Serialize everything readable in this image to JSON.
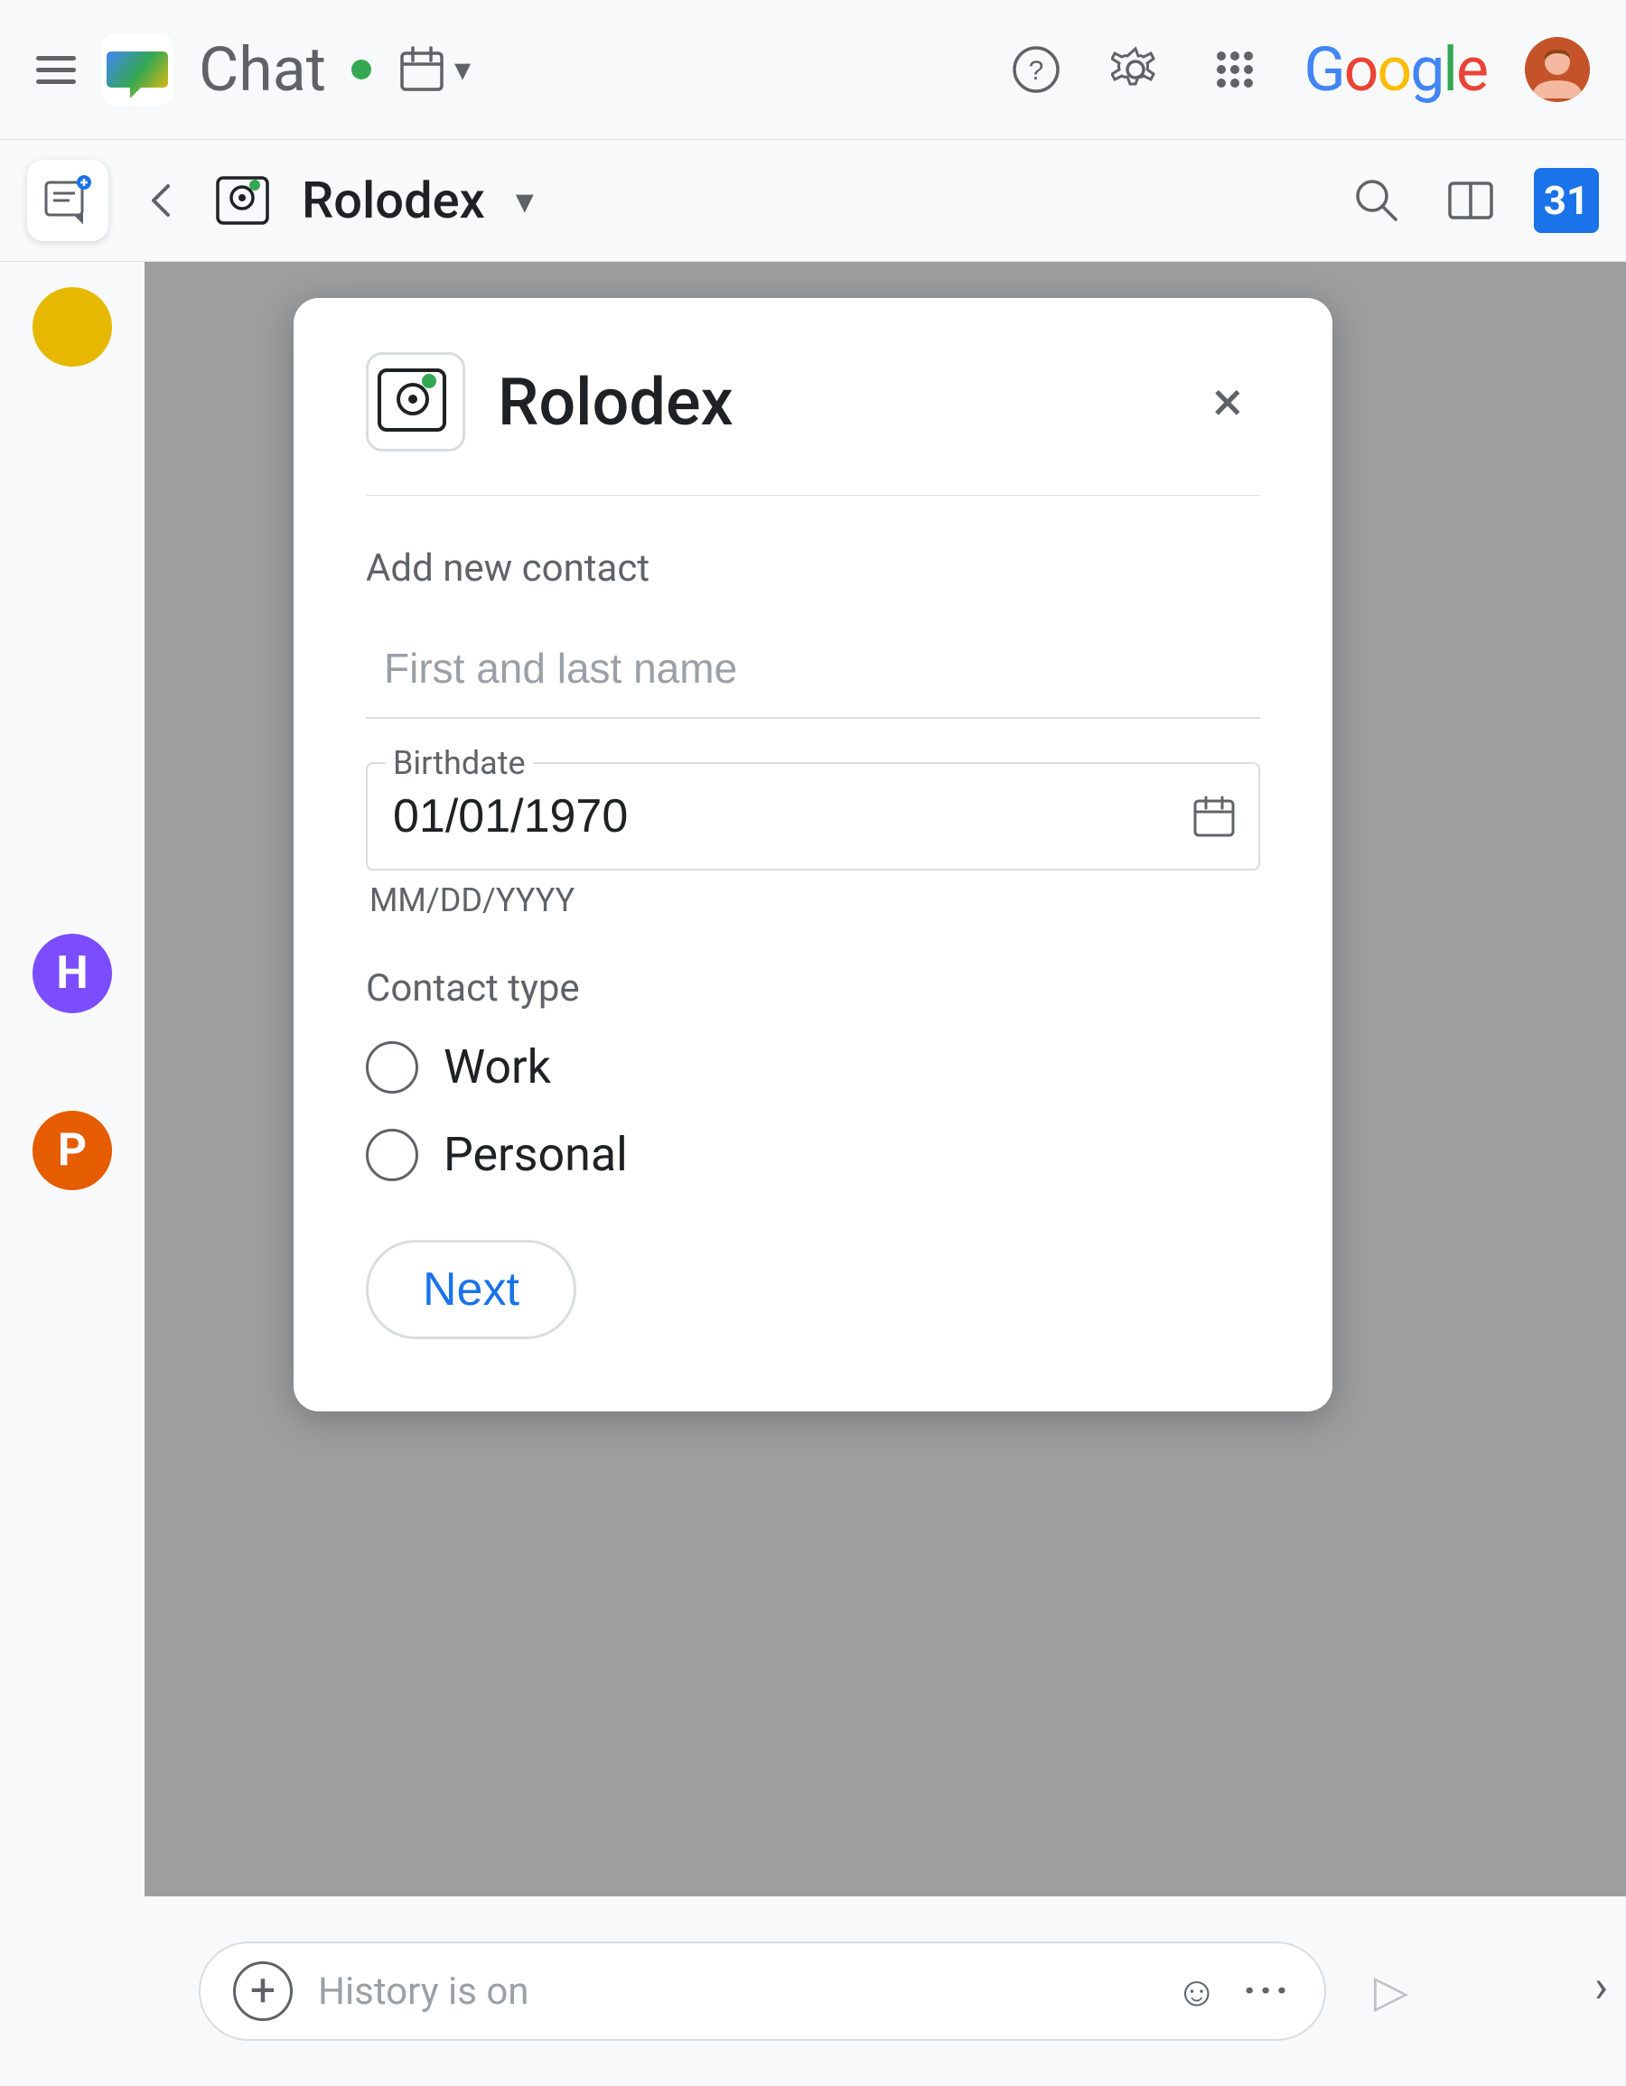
{
  "topbar": {
    "app_title": "Chat",
    "status_color": "#34a853",
    "google_text": "Google",
    "help_tooltip": "Help",
    "settings_tooltip": "Settings",
    "apps_tooltip": "Google apps"
  },
  "secondary_bar": {
    "channel_name": "Rolodex",
    "chevron": "▾",
    "calendar_number": "31"
  },
  "bottom_bar": {
    "placeholder": "History is on",
    "add_icon": "+",
    "emoji_icon": "☺",
    "more_icon": "•••",
    "send_icon": "▷"
  },
  "modal": {
    "title": "Rolodex",
    "close_label": "×",
    "section_label": "Add new contact",
    "name_placeholder": "First and last name",
    "birthdate_label": "Birthdate",
    "birthdate_value": "01/01/1970",
    "birthdate_hint": "MM/DD/YYYY",
    "contact_type_label": "Contact type",
    "contact_options": [
      {
        "id": "work",
        "label": "Work"
      },
      {
        "id": "personal",
        "label": "Personal"
      }
    ],
    "next_label": "Next"
  },
  "sidebar": {
    "bottom_avatars": [
      {
        "color": "#e6b800",
        "letter": "?"
      },
      {
        "color": "#7c4dff",
        "letter": "H"
      },
      {
        "color": "#e65c00",
        "letter": "P"
      }
    ]
  }
}
